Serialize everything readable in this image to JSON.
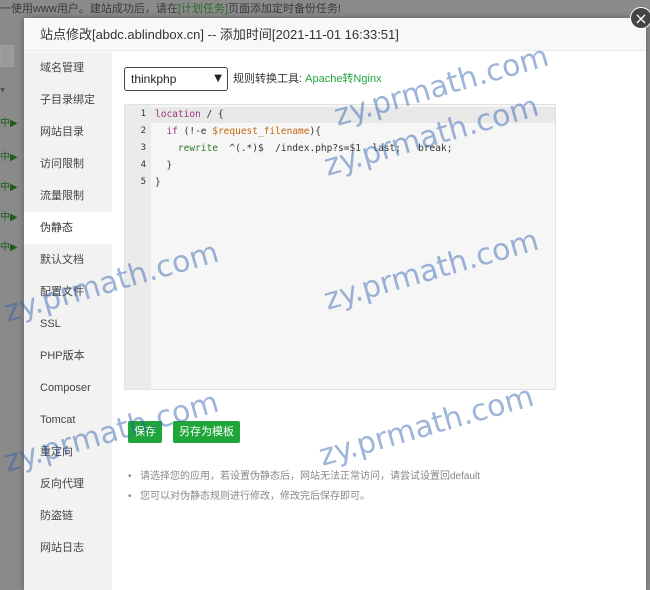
{
  "background": {
    "notice_prefix": "一使用www用户。建站成功后，请在",
    "notice_link": "[计划任务]",
    "notice_suffix": "页面添加定时备份任务!",
    "row_labels": [
      "中▶",
      "中▶",
      "中▶",
      "中▶",
      "中▶"
    ]
  },
  "dialog": {
    "title": "站点修改[abdc.ablindbox.cn] -- 添加时间[2021-11-01 16:33:51]",
    "close_icon": "close-icon"
  },
  "nav": {
    "items": [
      {
        "label": "域名管理",
        "active": false
      },
      {
        "label": "子目录绑定",
        "active": false
      },
      {
        "label": "网站目录",
        "active": false
      },
      {
        "label": "访问限制",
        "active": false
      },
      {
        "label": "流量限制",
        "active": false
      },
      {
        "label": "伪静态",
        "active": true
      },
      {
        "label": "默认文档",
        "active": false
      },
      {
        "label": "配置文件",
        "active": false
      },
      {
        "label": "SSL",
        "active": false
      },
      {
        "label": "PHP版本",
        "active": false
      },
      {
        "label": "Composer",
        "active": false
      },
      {
        "label": "Tomcat",
        "active": false
      },
      {
        "label": "重定向",
        "active": false
      },
      {
        "label": "反向代理",
        "active": false
      },
      {
        "label": "防盗链",
        "active": false
      },
      {
        "label": "网站日志",
        "active": false
      }
    ]
  },
  "rewrite": {
    "template_select": "thinkphp",
    "tool_label": "规则转换工具:",
    "tool_link": "Apache转Nginx",
    "line_numbers": [
      "1",
      "2",
      "3",
      "4",
      "5"
    ],
    "code": {
      "l1_kw": "location",
      "l1_rest": " / {",
      "l2_indent": "  ",
      "l2_if": "if",
      "l2_open": " (!-e ",
      "l2_var": "$request_filename",
      "l2_close": "){",
      "l3_indent": "    ",
      "l3_fn": "rewrite",
      "l3_rest": "  ^(.*)$  /index.php?s=$1  last;   break;",
      "l4": "  }",
      "l5": "}"
    },
    "save_button": "保存",
    "save_template_button": "另存为模板",
    "tips": [
      "请选择您的应用，若设置伪静态后，网站无法正常访问，请尝试设置回default",
      "您可以对伪静态规则进行修改，修改完后保存即可。"
    ]
  },
  "watermark": "zy.prmath.com",
  "colors": {
    "accent": "#20a53a",
    "nav_bg": "#f2f2f2",
    "overlay": "#7f7f7f"
  }
}
